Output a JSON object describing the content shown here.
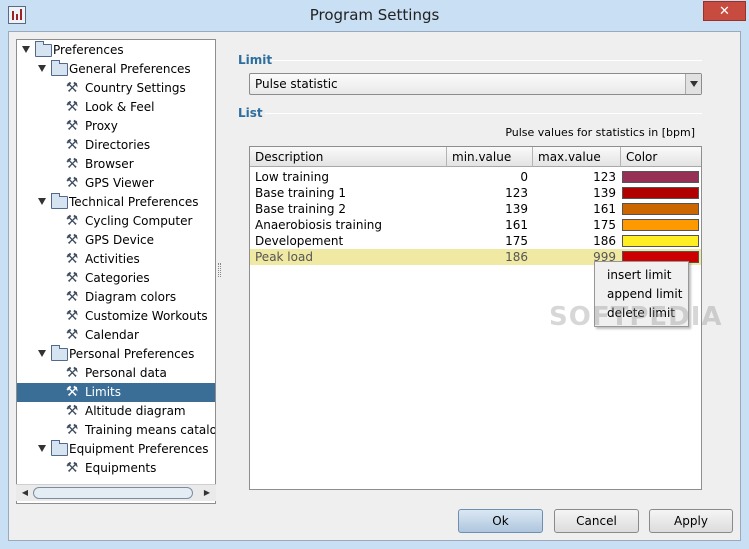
{
  "window": {
    "title": "Program Settings",
    "close_glyph": "✕"
  },
  "tree": {
    "items": [
      {
        "label": "Preferences",
        "level": 0,
        "type": "folder",
        "expanded": true
      },
      {
        "label": "General Preferences",
        "level": 1,
        "type": "folder",
        "expanded": true
      },
      {
        "label": "Country Settings",
        "level": 2,
        "type": "leaf"
      },
      {
        "label": "Look & Feel",
        "level": 2,
        "type": "leaf"
      },
      {
        "label": "Proxy",
        "level": 2,
        "type": "leaf"
      },
      {
        "label": "Directories",
        "level": 2,
        "type": "leaf"
      },
      {
        "label": "Browser",
        "level": 2,
        "type": "leaf"
      },
      {
        "label": "GPS Viewer",
        "level": 2,
        "type": "leaf"
      },
      {
        "label": "Technical Preferences",
        "level": 1,
        "type": "folder",
        "expanded": true
      },
      {
        "label": "Cycling Computer",
        "level": 2,
        "type": "leaf"
      },
      {
        "label": "GPS Device",
        "level": 2,
        "type": "leaf"
      },
      {
        "label": "Activities",
        "level": 2,
        "type": "leaf"
      },
      {
        "label": "Categories",
        "level": 2,
        "type": "leaf"
      },
      {
        "label": "Diagram colors",
        "level": 2,
        "type": "leaf"
      },
      {
        "label": "Customize Workouts",
        "level": 2,
        "type": "leaf"
      },
      {
        "label": "Calendar",
        "level": 2,
        "type": "leaf"
      },
      {
        "label": "Personal Preferences",
        "level": 1,
        "type": "folder",
        "expanded": true
      },
      {
        "label": "Personal data",
        "level": 2,
        "type": "leaf"
      },
      {
        "label": "Limits",
        "level": 2,
        "type": "leaf",
        "selected": true
      },
      {
        "label": "Altitude diagram",
        "level": 2,
        "type": "leaf"
      },
      {
        "label": "Training means catalog",
        "level": 2,
        "type": "leaf"
      },
      {
        "label": "Equipment Preferences",
        "level": 1,
        "type": "folder",
        "expanded": true
      },
      {
        "label": "Equipments",
        "level": 2,
        "type": "leaf"
      }
    ],
    "scroll_left_glyph": "◀",
    "scroll_right_glyph": "▶"
  },
  "limit_section": {
    "heading": "Limit",
    "dropdown": {
      "selected": "Pulse statistic"
    }
  },
  "list_section": {
    "heading": "List",
    "unit_note": "Pulse values for statistics in [bpm]",
    "columns": [
      "Description",
      "min.value",
      "max.value",
      "Color"
    ],
    "rows": [
      {
        "description": "Low training",
        "min": "0",
        "max": "123",
        "color": "#973055"
      },
      {
        "description": "Base training 1",
        "min": "123",
        "max": "139",
        "color": "#b00000"
      },
      {
        "description": "Base training 2",
        "min": "139",
        "max": "161",
        "color": "#cc6600"
      },
      {
        "description": "Anaerobiosis training",
        "min": "161",
        "max": "175",
        "color": "#ff9900"
      },
      {
        "description": "Developement",
        "min": "175",
        "max": "186",
        "color": "#ffee22"
      },
      {
        "description": "Peak load",
        "min": "186",
        "max": "999",
        "color": "#cc0000",
        "highlighted": true
      }
    ]
  },
  "context_menu": {
    "items": [
      "insert limit",
      "append limit",
      "delete limit"
    ]
  },
  "watermark": "SOFTPEDIA",
  "buttons": {
    "ok": "Ok",
    "cancel": "Cancel",
    "apply": "Apply"
  }
}
